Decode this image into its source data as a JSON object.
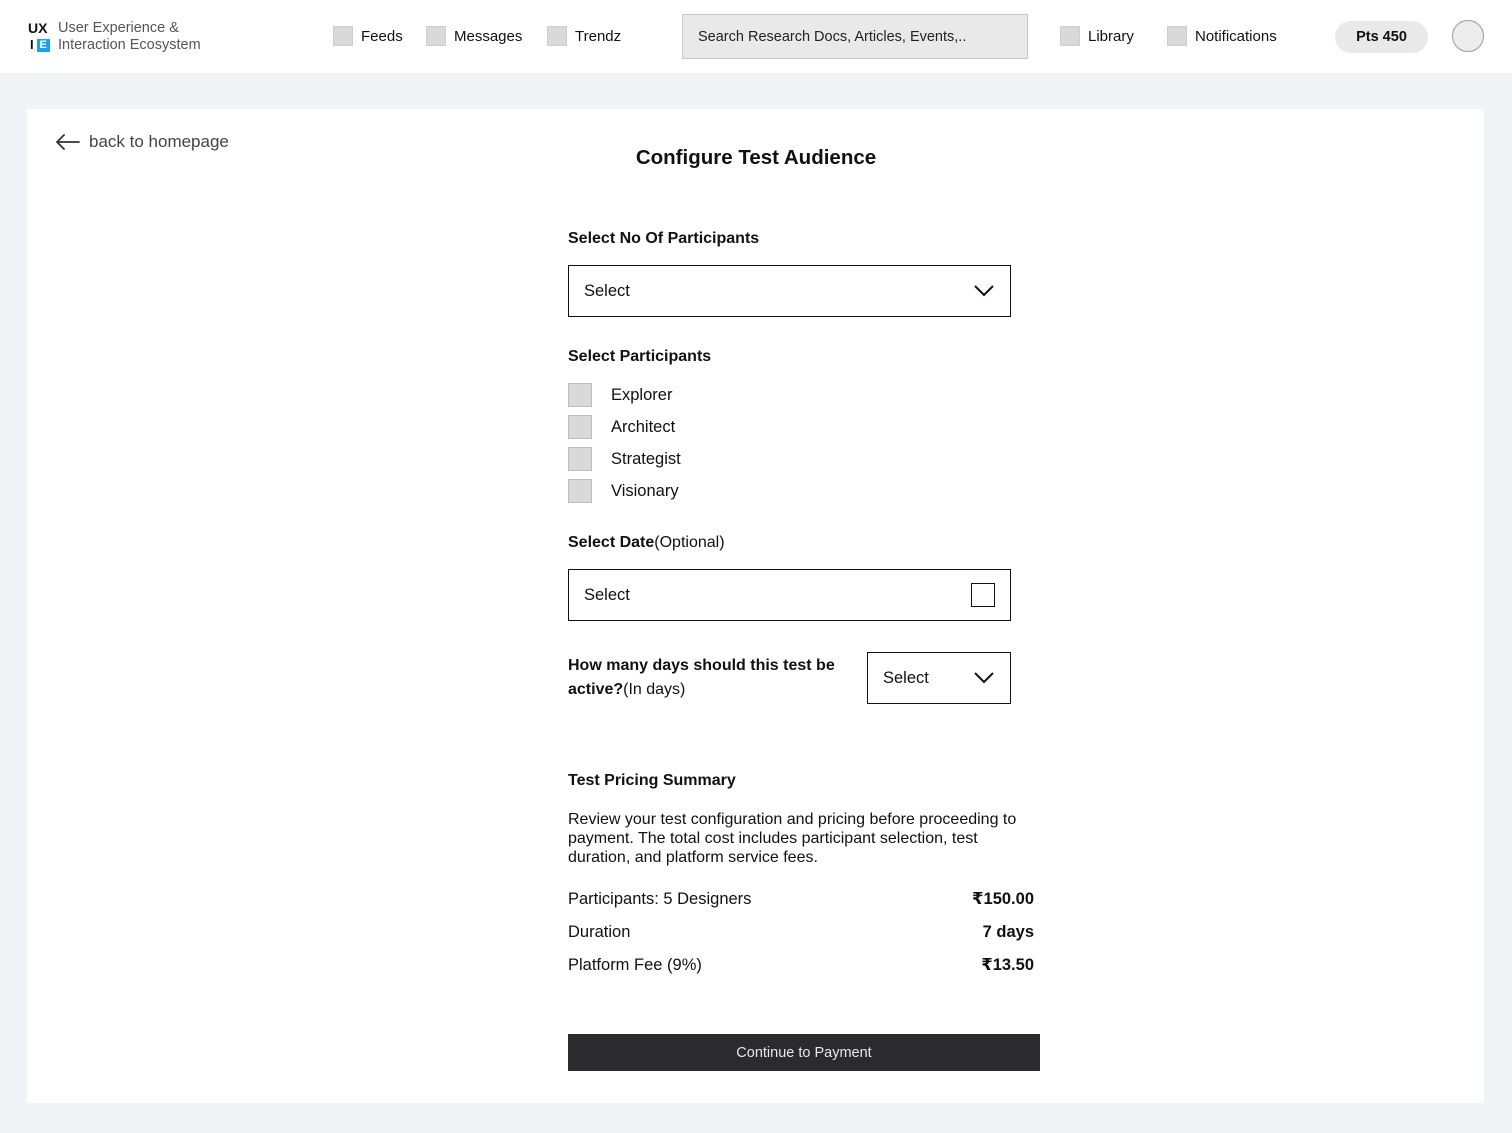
{
  "header": {
    "logo_line1": "UX",
    "logo_line2_i": "I",
    "logo_line2_e": "E",
    "logo_text_1": "User Experience &",
    "logo_text_2": "Interaction Ecosystem",
    "nav": {
      "feeds": "Feeds",
      "messages": "Messages",
      "trendz": "Trendz",
      "library": "Library",
      "notifications": "Notifications"
    },
    "search_placeholder": "Search Research Docs, Articles, Events,..",
    "points": "Pts 450"
  },
  "page": {
    "back_link": "back to homepage",
    "title": "Configure Test Audience"
  },
  "form": {
    "participants_count": {
      "label": "Select No Of Participants",
      "value": "Select"
    },
    "participants": {
      "label": "Select Participants",
      "options": [
        "Explorer",
        "Architect",
        "Strategist",
        "Visionary"
      ]
    },
    "date": {
      "label": "Select Date",
      "optional": "(Optional)",
      "value": "Select"
    },
    "days": {
      "question": "How many days should this test be active?",
      "unit": "(In days)",
      "value": "Select"
    }
  },
  "summary": {
    "title": "Test Pricing Summary",
    "description": "Review your test configuration and pricing before proceeding to payment. The total cost includes participant selection, test duration, and platform service fees.",
    "rows": [
      {
        "label": "Participants: 5 Designers",
        "value": "₹150.00"
      },
      {
        "label": "Duration",
        "value": "7 days"
      },
      {
        "label": "Platform Fee (9%)",
        "value": "₹13.50"
      }
    ]
  },
  "actions": {
    "continue": "Continue to Payment"
  }
}
